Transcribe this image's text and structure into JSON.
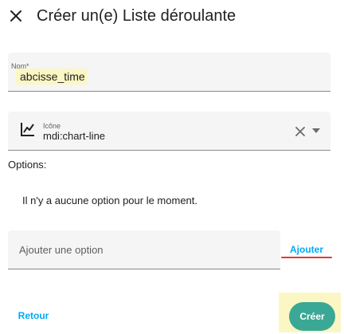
{
  "dialog": {
    "title": "Créer un(e) Liste déroulante",
    "close_icon": "close-icon"
  },
  "name_field": {
    "label": "Nom*",
    "value": "abcisse_time"
  },
  "icon_field": {
    "icon": "chart-line-icon",
    "label": "Icône",
    "value": "mdi:chart-line",
    "clear_icon": "clear-icon",
    "dropdown_icon": "dropdown-arrow-icon"
  },
  "options": {
    "label": "Options:",
    "empty_message": "Il n'y a aucune option pour le moment.",
    "add_placeholder": "Ajouter une option",
    "add_button": "Ajouter"
  },
  "actions": {
    "back": "Retour",
    "create": "Créer"
  },
  "colors": {
    "accent": "#03a9f4",
    "primary_button": "#3aa895",
    "highlight": "#fbf7c4",
    "annotation": "#e53935"
  }
}
